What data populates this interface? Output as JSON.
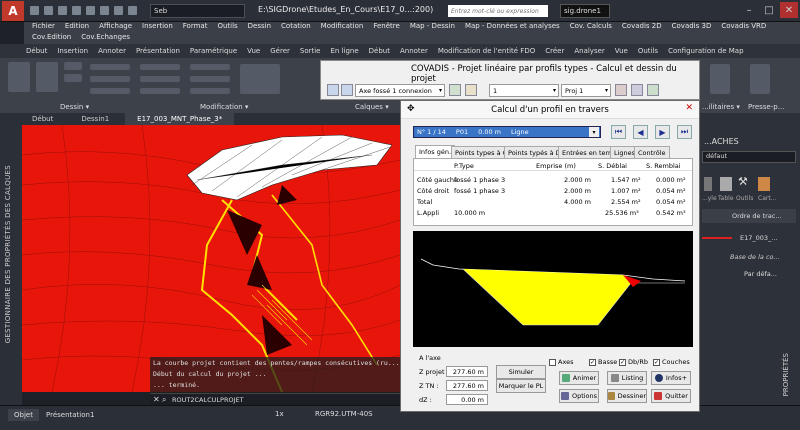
{
  "titlebar": {
    "workspace": "Seb",
    "window_title": "E:\\SIGDrone\\Etudes_En_Cours\\E17_0...:200)",
    "search_placeholder": "Entrez mot-clé ou expression",
    "user": "sig.drone1"
  },
  "menus": {
    "row1": [
      "Fichier",
      "Edition",
      "Affichage",
      "Insertion",
      "Format",
      "Outils",
      "Dessin",
      "Cotation",
      "Modification",
      "Fenêtre",
      "Map - Dessin",
      "Map - Données et analyses",
      "Cov. Calculs",
      "Covadis 2D",
      "Covadis 3D",
      "Covadis VRD"
    ],
    "row2": [
      "Cov.Edition",
      "Cov.Echanges"
    ]
  },
  "ribbon_tabs": [
    "Début",
    "Insertion",
    "Annoter",
    "Présentation",
    "Paramétrique",
    "Vue",
    "Gérer",
    "Sortie",
    "En ligne",
    "Début",
    "Annoter",
    "Modification de l'entité FDO",
    "Créer",
    "Analyser",
    "Vue",
    "Outils",
    "Configuration de Map"
  ],
  "ribbon_panels": {
    "dessin": "Dessin",
    "modification": "Modification",
    "calques": "Calques",
    "utilitaires": "...ilitaires",
    "presse": "Presse-p..."
  },
  "covadis_toolbar": {
    "title": "COVADIS - Projet linéaire par profils types - Calcul et dessin du projet",
    "axis": "Axe fossé 1 connexion",
    "num": "1",
    "proj": "Proj 1"
  },
  "doc_tabs": [
    "Début",
    "Dessin1",
    "E17_003_MNT_Phase_3*"
  ],
  "left_palette": "GESTIONNAIRE DES PROPRIÉTÉS DES CALQUES",
  "console": {
    "lines": [
      "La courbe projet contient des pentes/rampes consécutives (ru...",
      "Début du calcul du projet ...",
      "... terminé."
    ],
    "command": "ROUT2CALCULPROJET"
  },
  "status": {
    "tabs": [
      "Objet",
      "Présentation1"
    ],
    "scale": "1x",
    "coord_system": "RGR92.UTM-40S"
  },
  "right_panel": {
    "title": "...ACHES",
    "dropdown": "défaut",
    "icons": [
      "...yle",
      "Table",
      "Outils",
      "Cart..."
    ],
    "item1": "Ordre de trac...",
    "item2": "E17_003_...",
    "item3": "Base de la co...",
    "item4": "Par défa...",
    "vertical": "PROPRIÉTÉS"
  },
  "dialog": {
    "title": "Calcul d'un profil en travers",
    "profile_sel": {
      "index": "N° 1 / 14",
      "name": "P01",
      "dist": "0.00 m",
      "kind": "Ligne"
    },
    "tabs": [
      "Infos gén.",
      "Points types à G",
      "Points typés à D",
      "Entrées en terre",
      "Lignes",
      "Contrôle"
    ],
    "table": {
      "headers": [
        "",
        "P.Type",
        "Emprise (m)",
        "S. Déblai",
        "S. Remblai"
      ],
      "rows": [
        [
          "Côté gauche",
          "fossé 1 phase 3",
          "2.000 m",
          "1.547 m²",
          "0.000 m²"
        ],
        [
          "Côté droit",
          "fossé 1 phase 3",
          "2.000 m",
          "1.007 m²",
          "0.054 m²"
        ],
        [
          "Total",
          "",
          "4.000 m",
          "2.554 m²",
          "0.054 m²"
        ],
        [
          "L.Appli",
          "10.000 m",
          "",
          "25.536 m³",
          "0.542 m³"
        ]
      ]
    },
    "checkboxes": [
      {
        "label": "Axes",
        "checked": false
      },
      {
        "label": "Basse",
        "checked": true
      },
      {
        "label": "Db/Rb",
        "checked": true
      },
      {
        "label": "Couches",
        "checked": true
      }
    ],
    "axe_label": "A l'axe",
    "zprojet_label": "Z projet :",
    "zprojet": "277.60 m",
    "ztn_label": "Z TN :",
    "ztn": "277.60 m",
    "dz_label": "dZ :",
    "dz": "0.00 m",
    "btn_simuler": "Simuler",
    "btn_marquer": "Marquer le PL",
    "btn_animer": "Animer",
    "btn_listing": "Listing",
    "btn_infos": "Infos+",
    "btn_options": "Options",
    "btn_dessiner": "Dessiner",
    "btn_quitter": "Quitter"
  }
}
